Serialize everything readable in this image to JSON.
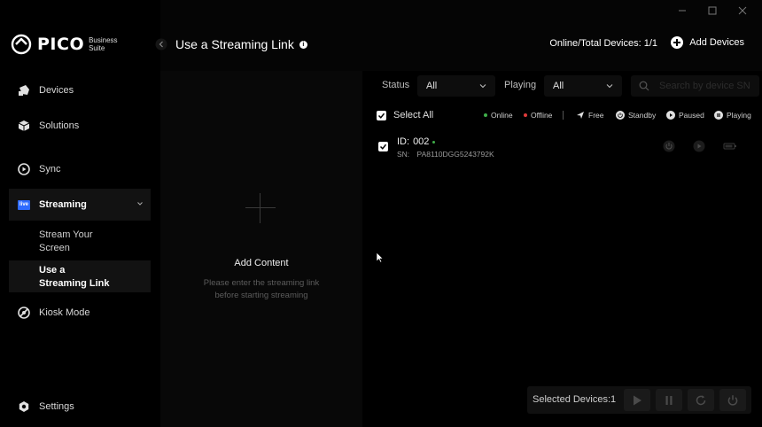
{
  "app": {
    "brand": "PICO",
    "brand_sub_line1": "Business",
    "brand_sub_line2": "Suite"
  },
  "sidebar": {
    "items": [
      {
        "label": "Devices",
        "icon": "headset-icon"
      },
      {
        "label": "Solutions",
        "icon": "cube-icon"
      },
      {
        "label": "Sync",
        "icon": "play-circle-icon"
      },
      {
        "label": "Streaming",
        "icon": "live-badge-icon"
      },
      {
        "label": "Kiosk Mode",
        "icon": "kiosk-icon"
      },
      {
        "label": "Settings",
        "icon": "gear-icon"
      }
    ],
    "streaming_sub": [
      {
        "label_line1": "Stream Your",
        "label_line2": "Screen"
      },
      {
        "label_line1": "Use a",
        "label_line2": "Streaming Link"
      }
    ],
    "live_badge": "live"
  },
  "header": {
    "title": "Use a Streaming Link",
    "info_glyph": "i",
    "online_total": "Online/Total Devices: 1/1",
    "add_devices": "Add Devices"
  },
  "content_panel": {
    "title": "Add Content",
    "hint_line1": "Please enter the streaming link",
    "hint_line2": "before starting streaming"
  },
  "filters": {
    "status_label": "Status",
    "status_value": "All",
    "playing_label": "Playing",
    "playing_value": "All",
    "search_placeholder": "Search by device SN"
  },
  "device_list": {
    "select_all": "Select All",
    "legend": {
      "online": "Online",
      "offline": "Offline",
      "free": "Free",
      "standby": "Standby",
      "paused": "Paused",
      "playing": "Playing"
    },
    "devices": [
      {
        "id_label": "ID:",
        "id": "002",
        "sn_label": "SN:",
        "sn": "PA8110DGG5243792K",
        "status": "online"
      }
    ]
  },
  "action_bar": {
    "selected_label": "Selected Devices:1"
  },
  "colors": {
    "online": "#3fae49",
    "offline": "#e03a3a",
    "accent_white": "#ffffff",
    "background": "#000000"
  }
}
